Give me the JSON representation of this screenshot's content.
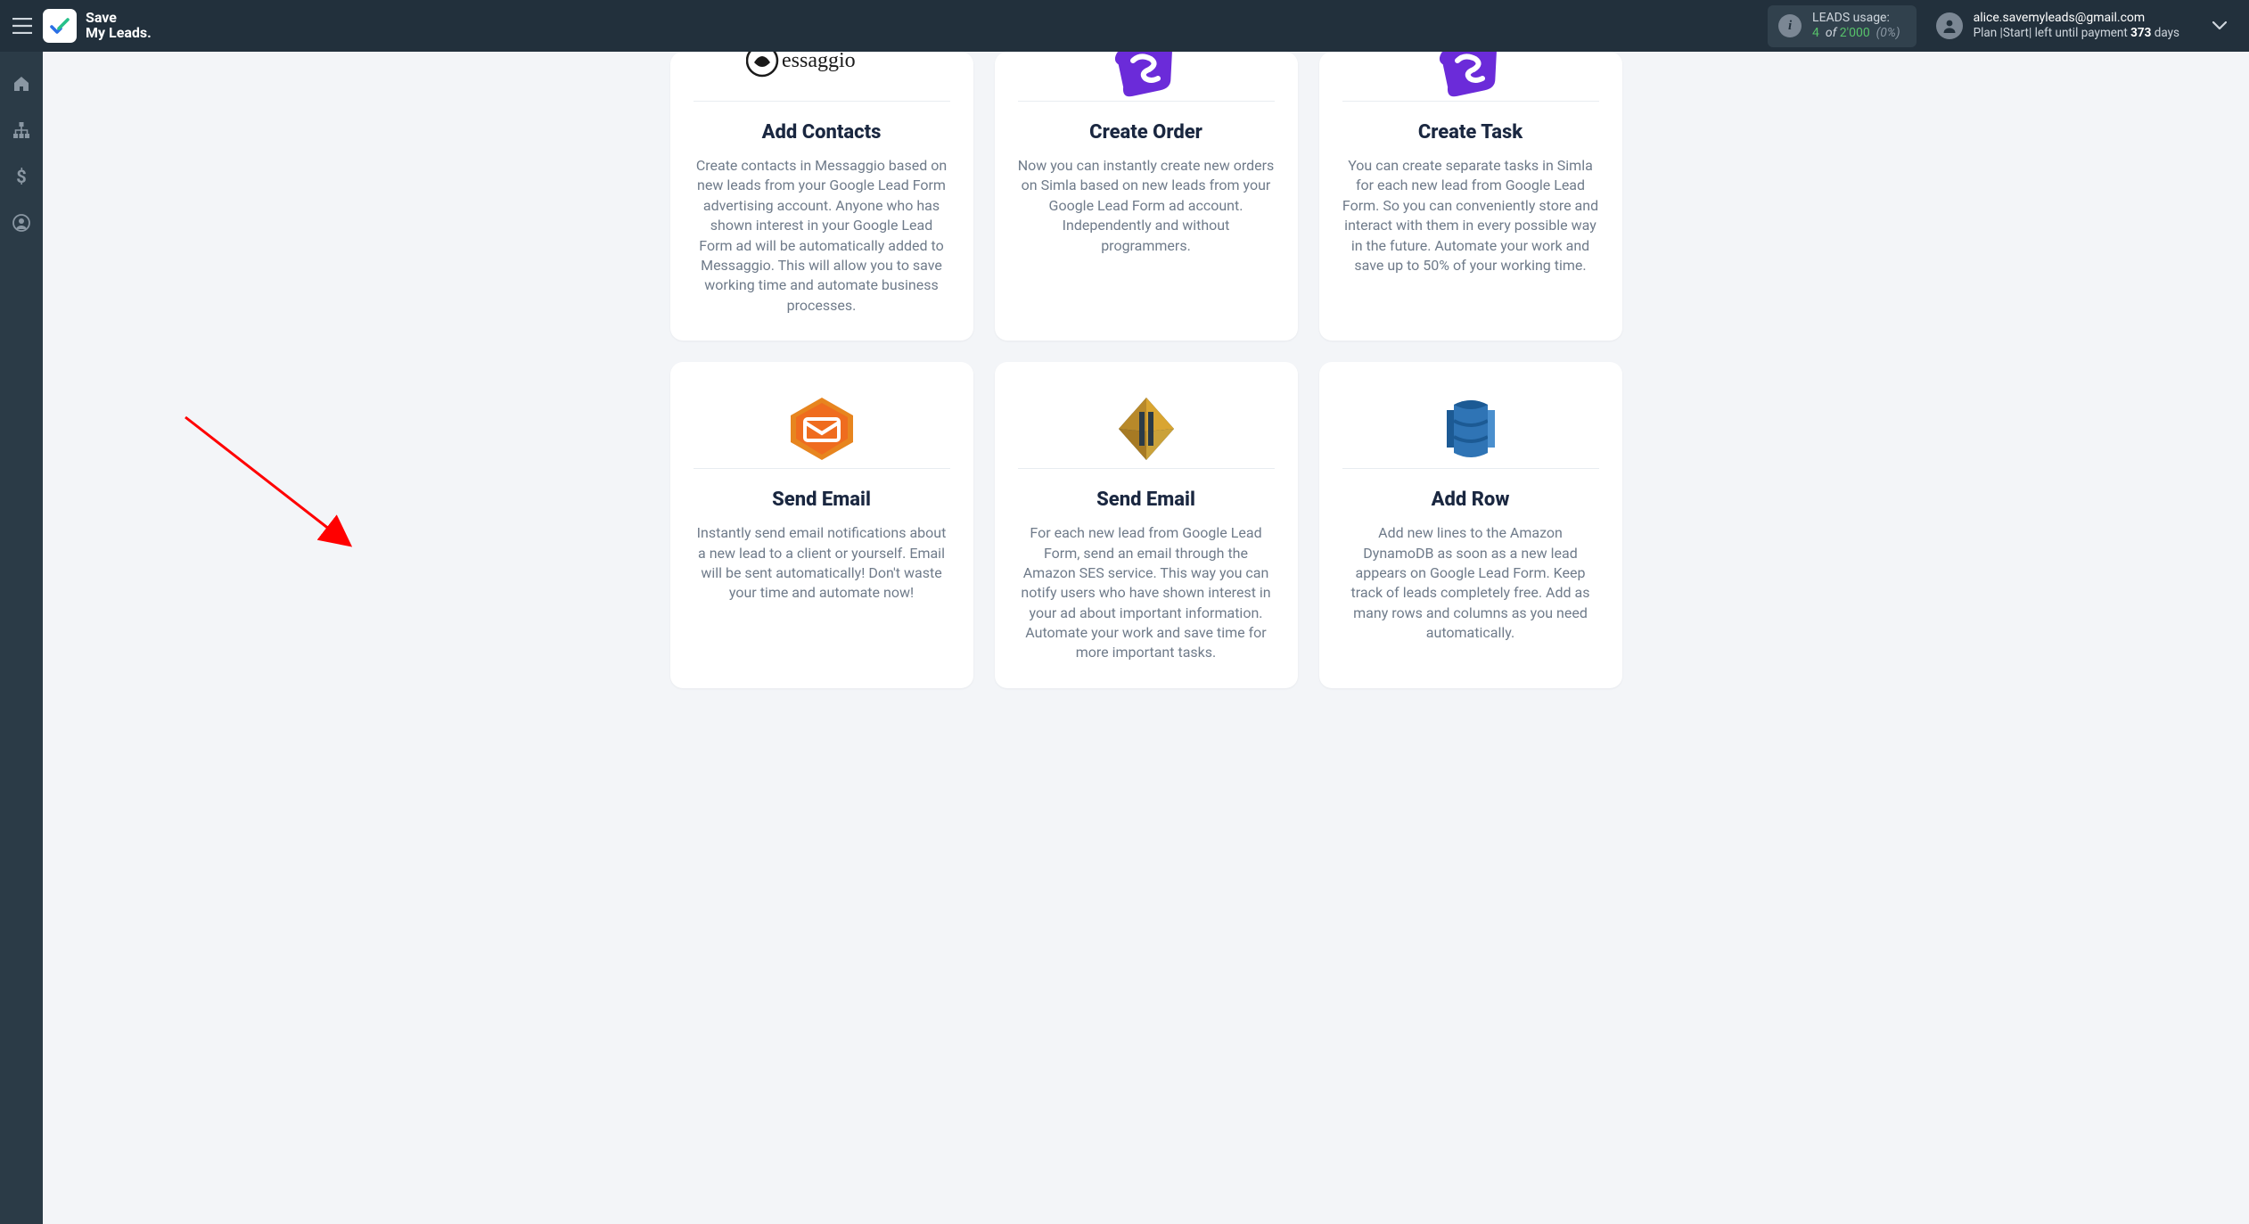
{
  "header": {
    "brand_line1": "Save",
    "brand_line2": "My Leads.",
    "usage_label": "LEADS usage:",
    "usage_used": "4",
    "usage_of_word": "of",
    "usage_total": "2'000",
    "usage_pct": "(0%)",
    "account_email": "alice.savemyleads@gmail.com",
    "plan_prefix": "Plan |",
    "plan_name": "Start",
    "plan_mid": "| left until payment",
    "plan_days_value": "373",
    "plan_days_word": "days"
  },
  "sidebar": {
    "items": [
      {
        "name": "home"
      },
      {
        "name": "integrations"
      },
      {
        "name": "billing"
      },
      {
        "name": "account"
      }
    ]
  },
  "cards_row1": [
    {
      "icon": "messaggio",
      "title": "Add Contacts",
      "desc": "Create contacts in Messaggio based on new leads from your Google Lead Form advertising account. Anyone who has shown interest in your Google Lead Form ad will be automatically added to Messaggio. This will allow you to save working time and automate business processes."
    },
    {
      "icon": "simla",
      "title": "Create Order",
      "desc": "Now you can instantly create new orders on Simla based on new leads from your Google Lead Form ad account. Independently and without programmers."
    },
    {
      "icon": "simla",
      "title": "Create Task",
      "desc": "You can create separate tasks in Simla for each new lead from Google Lead Form. So you can conveniently store and interact with them in every possible way in the future. Automate your work and save up to 50% of your working time."
    }
  ],
  "cards_row2": [
    {
      "icon": "sml-email",
      "title": "Send Email",
      "desc": "Instantly send email notifications about a new lead to a client or yourself. Email will be sent automatically! Don't waste your time and automate now!"
    },
    {
      "icon": "amazon-ses",
      "title": "Send Email",
      "desc": "For each new lead from Google Lead Form, send an email through the Amazon SES service. This way you can notify users who have shown interest in your ad about important information. Automate your work and save time for more important tasks."
    },
    {
      "icon": "dynamodb",
      "title": "Add Row",
      "desc": "Add new lines to the Amazon DynamoDB as soon as a new lead appears on Google Lead Form. Keep track of leads completely free. Add as many rows and columns as you need automatically."
    }
  ]
}
